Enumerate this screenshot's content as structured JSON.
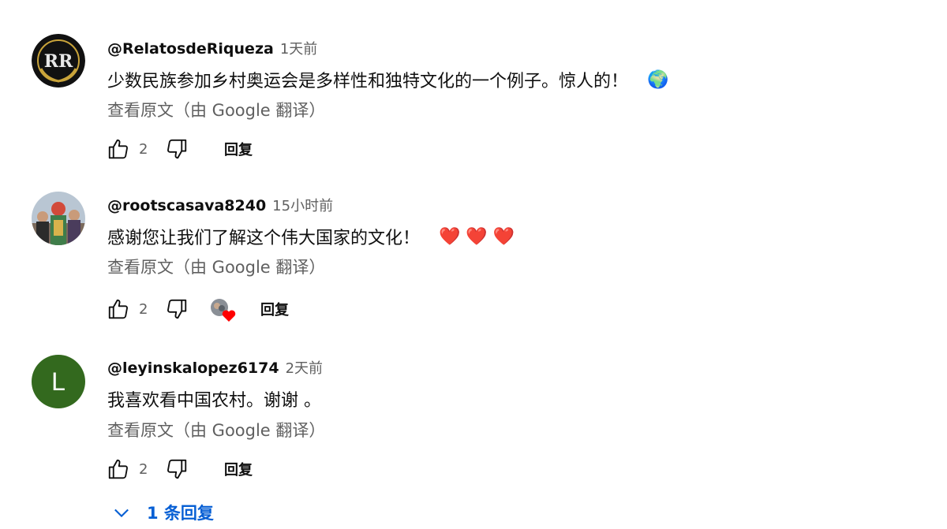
{
  "translate_label": "查看原文（由 Google 翻译）",
  "reply_label": "回复",
  "comments": [
    {
      "author": "@RelatosdeRiqueza",
      "time": "1天前",
      "text": "少数民族参加乡村奥运会是多样性和独特文化的一个例子。惊人的！",
      "emoji": "🌍",
      "likes": "2",
      "avatar_text": "RR"
    },
    {
      "author": "@rootscasava8240",
      "time": "15小时前",
      "text": "感谢您让我们了解这个伟大国家的文化！",
      "emoji": "❤️ ❤️ ❤️",
      "likes": "2",
      "creator_heart": true
    },
    {
      "author": "@leyinskalopez6174",
      "time": "2天前",
      "text": "我喜欢看中国农村。谢谢 。",
      "likes": "2",
      "avatar_letter": "L",
      "avatar_color": "#33691e"
    }
  ],
  "replies_toggle": "1 条回复",
  "colors": {
    "link_blue": "#065fd4",
    "secondary": "#606060",
    "heart": "#ff0000"
  }
}
